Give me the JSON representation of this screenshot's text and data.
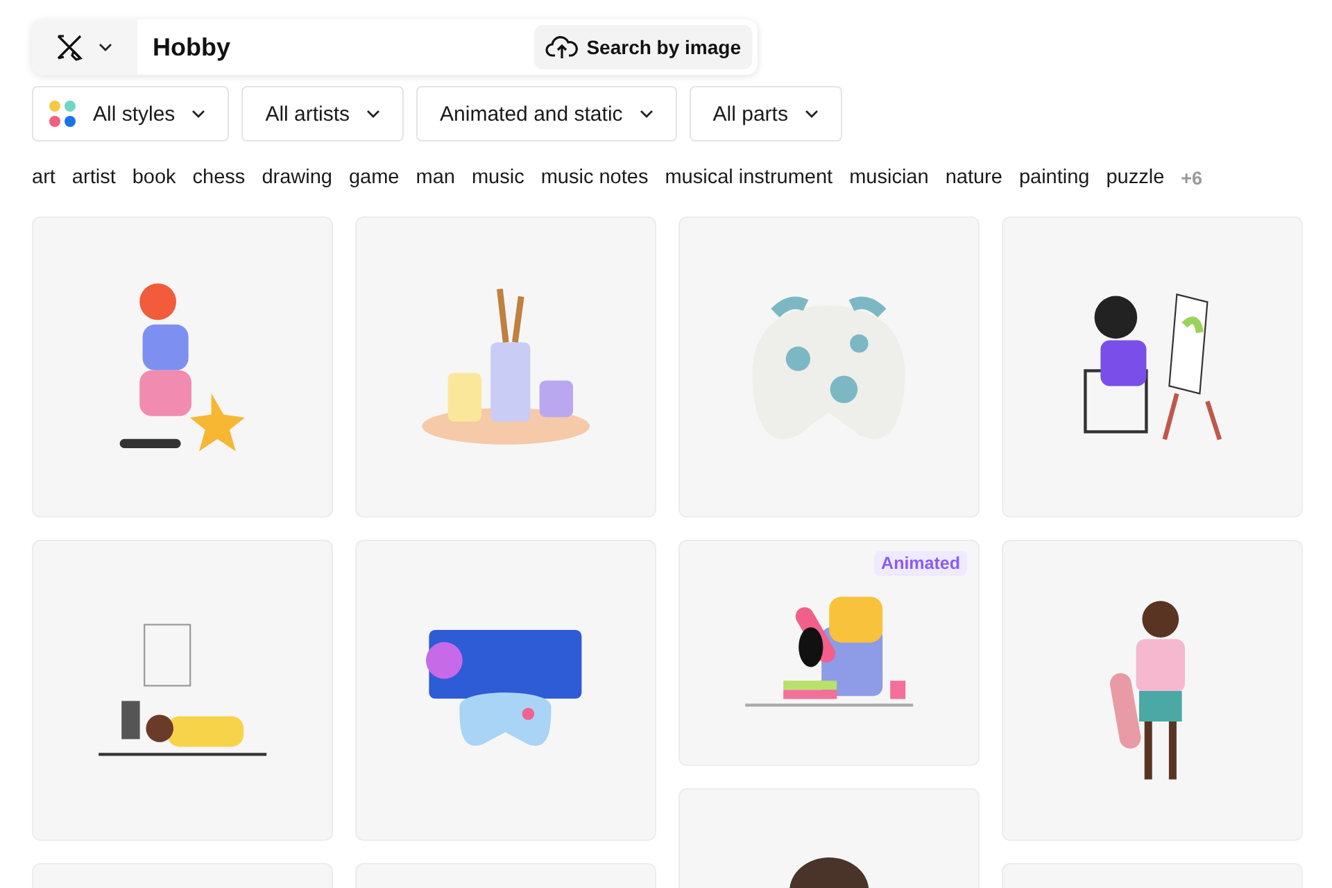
{
  "search": {
    "query": "Hobby",
    "image_search": "Search by image"
  },
  "filters": [
    {
      "label": "All styles",
      "kind": "styles"
    },
    {
      "label": "All artists",
      "kind": "plain"
    },
    {
      "label": "Animated and static",
      "kind": "plain"
    },
    {
      "label": "All parts",
      "kind": "plain"
    }
  ],
  "tags": [
    "art",
    "artist",
    "book",
    "chess",
    "drawing",
    "game",
    "man",
    "music",
    "music notes",
    "musical instrument",
    "musician",
    "nature",
    "painting",
    "puzzle"
  ],
  "more_tags": "+6",
  "columns": [
    {
      "cards": [
        {
          "kind": "skater"
        },
        {
          "kind": "desk"
        },
        {
          "kind": "blank"
        }
      ]
    },
    {
      "cards": [
        {
          "kind": "paints"
        },
        {
          "kind": "gamer"
        },
        {
          "kind": "blank"
        }
      ]
    },
    {
      "cards": [
        {
          "kind": "gamepad"
        },
        {
          "kind": "reader",
          "badge": "Animated"
        },
        {
          "kind": "head"
        }
      ]
    },
    {
      "cards": [
        {
          "kind": "painter"
        },
        {
          "kind": "person"
        },
        {
          "kind": "blank"
        }
      ]
    }
  ]
}
